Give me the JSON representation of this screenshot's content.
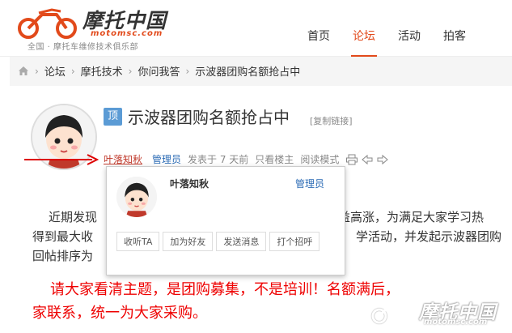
{
  "site": {
    "logo_title": "摩托中国",
    "logo_domain": "motomsc.com",
    "slogan": "全国 · 摩托车维修技术俱乐部",
    "accent_color": "#e24a1b"
  },
  "nav": {
    "items": [
      {
        "label": "首页",
        "active": false
      },
      {
        "label": "论坛",
        "active": true
      },
      {
        "label": "活动",
        "active": false
      },
      {
        "label": "photo_label",
        "label_text": "拍客",
        "active": false
      }
    ]
  },
  "breadcrumb": {
    "items": [
      "论坛",
      "摩托技术",
      "你问我答",
      "示波器团购名额抢占中"
    ]
  },
  "post": {
    "badge": "顶",
    "title": "示波器团购名额抢占中",
    "copy_link": "[复制链接]",
    "author": "叶落知秋",
    "role": "管理员",
    "posted": "发表于 7 天前",
    "only_author": "只看楼主",
    "read_mode": "阅读模式",
    "para1": "近期发现",
    "para1_end": "益高涨，为满足大家学习热",
    "para2": "得到最大收",
    "para2_end": "学活动，并发起示波器团购",
    "para3": "回帖排序为",
    "red1": "请大家看清主题，是团购募集，不是培训！名额满后，",
    "red2": "家联系，统一为大家采购。"
  },
  "popup": {
    "name": "叶落知秋",
    "role": "管理员",
    "actions": [
      "收听TA",
      "加为好友",
      "发送消息",
      "打个招呼"
    ]
  },
  "watermark": {
    "text": "摩托中国",
    "domain": "motomsc.com"
  }
}
